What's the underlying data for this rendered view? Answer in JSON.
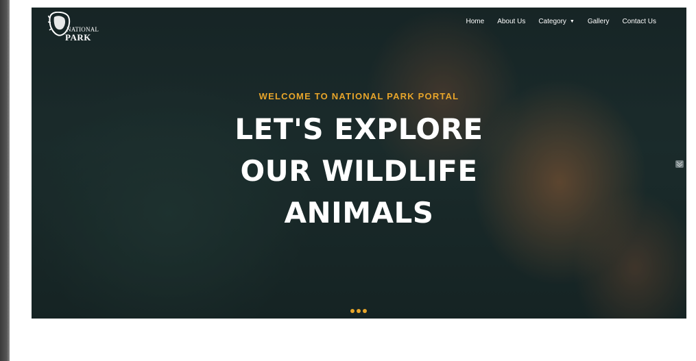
{
  "brand": {
    "line1": "NATIONAL",
    "line2": "PARK",
    "icon": "lion-head-icon"
  },
  "nav": {
    "items": [
      {
        "label": "Home"
      },
      {
        "label": "About Us"
      },
      {
        "label": "Category"
      },
      {
        "label": "Gallery"
      },
      {
        "label": "Contact Us"
      }
    ]
  },
  "hero": {
    "eyebrow": "WELCOME TO NATIONAL PARK PORTAL",
    "title_line1": "LET'S EXPLORE",
    "title_line2": "OUR WILDLIFE",
    "title_line3": "ANIMALS",
    "slide_count": 3,
    "active_slide": 1
  },
  "colors": {
    "accent": "#e8a52a",
    "text": "#ffffff",
    "overlay": "#1c2b2c"
  }
}
